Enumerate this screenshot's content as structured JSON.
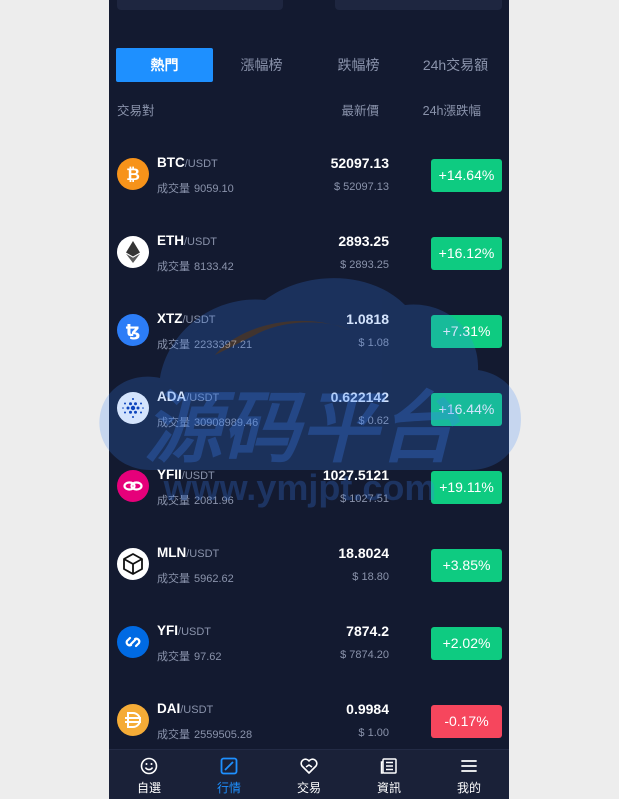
{
  "tabs": [
    {
      "label": "熱門",
      "active": true
    },
    {
      "label": "漲幅榜",
      "active": false
    },
    {
      "label": "跌幅榜",
      "active": false
    },
    {
      "label": "24h交易額",
      "active": false
    }
  ],
  "headers": {
    "pair": "交易對",
    "price": "最新價",
    "change": "24h漲跌幅"
  },
  "vol_label": "成交量",
  "coins": [
    {
      "symbol": "BTC",
      "quote": "/USDT",
      "volume": "9059.10",
      "price": "52097.13",
      "fiat": "$ 52097.13",
      "change": "+14.64%",
      "trend": "up",
      "icon": "bitcoin-icon",
      "icon_color": "#f7931a"
    },
    {
      "symbol": "ETH",
      "quote": "/USDT",
      "volume": "8133.42",
      "price": "2893.25",
      "fiat": "$ 2893.25",
      "change": "+16.12%",
      "trend": "up",
      "icon": "ethereum-icon",
      "icon_color": "#ffffff"
    },
    {
      "symbol": "XTZ",
      "quote": "/USDT",
      "volume": "2233397.21",
      "price": "1.0818",
      "fiat": "$ 1.08",
      "change": "+7.31%",
      "trend": "up",
      "icon": "tezos-icon",
      "icon_color": "#2c7df7"
    },
    {
      "symbol": "ADA",
      "quote": "/USDT",
      "volume": "30908989.46",
      "price": "0.622142",
      "fiat": "$ 0.62",
      "change": "+16.44%",
      "trend": "up",
      "icon": "cardano-icon",
      "icon_color": "#ffffff"
    },
    {
      "symbol": "YFII",
      "quote": "/USDT",
      "volume": "2081.96",
      "price": "1027.5121",
      "fiat": "$ 1027.51",
      "change": "+19.11%",
      "trend": "up",
      "icon": "yfii-icon",
      "icon_color": "#e6007a"
    },
    {
      "symbol": "MLN",
      "quote": "/USDT",
      "volume": "5962.62",
      "price": "18.8024",
      "fiat": "$ 18.80",
      "change": "+3.85%",
      "trend": "up",
      "icon": "melon-icon",
      "icon_color": "#ffffff"
    },
    {
      "symbol": "YFI",
      "quote": "/USDT",
      "volume": "97.62",
      "price": "7874.2",
      "fiat": "$ 7874.20",
      "change": "+2.02%",
      "trend": "up",
      "icon": "yearn-icon",
      "icon_color": "#006ae3"
    },
    {
      "symbol": "DAI",
      "quote": "/USDT",
      "volume": "2559505.28",
      "price": "0.9984",
      "fiat": "$ 1.00",
      "change": "-0.17%",
      "trend": "down",
      "icon": "dai-icon",
      "icon_color": "#f5ac37"
    }
  ],
  "colors": {
    "up": "#0ecb81",
    "down": "#f6465d",
    "accent": "#1e90ff",
    "background": "#131a30"
  },
  "watermark": {
    "title": "源码平台",
    "url": "www.ymjpt.com"
  },
  "nav": [
    {
      "label": "自選",
      "icon": "smile-icon",
      "active": false
    },
    {
      "label": "行情",
      "icon": "chart-icon",
      "active": true
    },
    {
      "label": "交易",
      "icon": "trade-icon",
      "active": false
    },
    {
      "label": "資訊",
      "icon": "news-icon",
      "active": false
    },
    {
      "label": "我的",
      "icon": "menu-icon",
      "active": false
    }
  ]
}
